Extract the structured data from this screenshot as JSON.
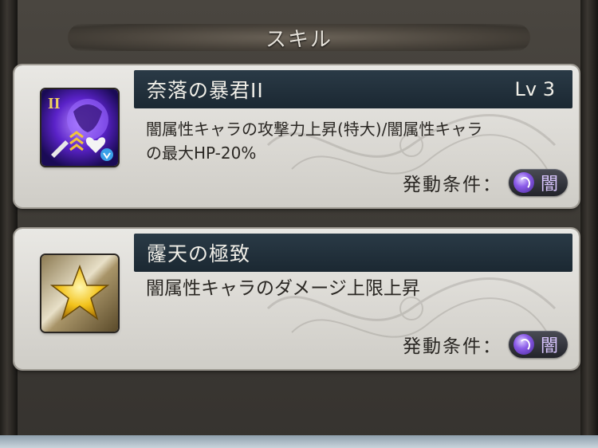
{
  "section": {
    "title": "スキル"
  },
  "skills": [
    {
      "name": "奈落の暴君II",
      "level": "Lv 3",
      "description_lines": [
        "闇属性キャラの攻撃力上昇(特大)/闇属性キャラ",
        "の最大HP-20%"
      ],
      "condition_label": "発動条件：",
      "element": "闇",
      "icon": "dark-skill-icon",
      "icon_badge": "II"
    },
    {
      "name": "霳天の極致",
      "level": "",
      "description_lines": [
        "闇属性キャラのダメージ上限上昇"
      ],
      "condition_label": "発動条件：",
      "element": "闇",
      "icon": "gold-star-icon"
    }
  ],
  "colors": {
    "title_bar": "#1f2c36",
    "dark_element": "#8a5ae8",
    "card_bg": "#dcdad5"
  }
}
